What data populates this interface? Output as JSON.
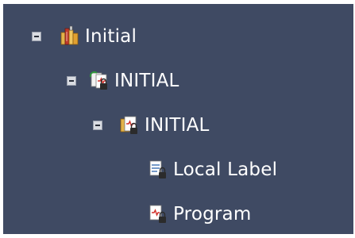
{
  "tree": {
    "nodes": [
      {
        "label": "Initial",
        "icon": "project-books-icon",
        "expanded": true
      },
      {
        "label": "INITIAL",
        "icon": "task-program-icon",
        "expanded": true
      },
      {
        "label": "INITIAL",
        "icon": "program-block-icon",
        "expanded": true
      },
      {
        "label": "Local Label",
        "icon": "local-label-icon",
        "expanded": false
      },
      {
        "label": "Program",
        "icon": "program-icon",
        "expanded": false
      }
    ]
  },
  "colors": {
    "panel_background": "#3f4a63",
    "text": "#ffffff"
  }
}
